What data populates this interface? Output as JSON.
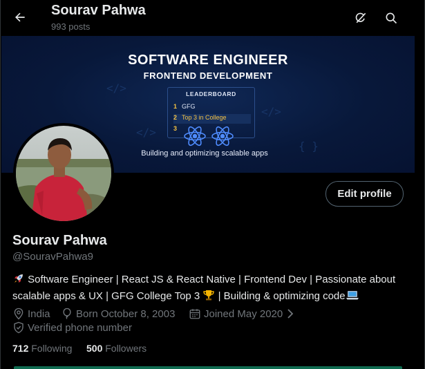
{
  "header": {
    "title": "Sourav Pahwa",
    "posts": "993 posts"
  },
  "banner": {
    "title": "SOFTWARE ENGINEER",
    "subtitle": "FRONTEND DEVELOPMENT",
    "leaderboard_title": "LEADERBOARD",
    "leaderboard_rows": [
      {
        "rank": "1",
        "text": "GFG"
      },
      {
        "rank": "2",
        "text": "Top 3 in College"
      },
      {
        "rank": "3",
        "text": ""
      }
    ],
    "caption": "Building and optimizing scalable apps"
  },
  "profile": {
    "edit_label": "Edit profile",
    "name": "Sourav Pahwa",
    "handle": "@SouravPahwa9",
    "bio_line1": "Software Engineer | React JS & React Native | Frontend Dev | Passionate about",
    "bio_line2a": "scalable apps & UX | GFG College Top 3",
    "bio_line2b": "| Building & optimizing code",
    "location": "India",
    "born": "Born October 8, 2003",
    "joined": "Joined May 2020",
    "verified": "Verified phone number",
    "following_count": "712",
    "following_label": "Following",
    "followers_count": "500",
    "followers_label": "Followers"
  },
  "colors": {
    "background": "#000000",
    "primary_text": "#e7e9ea",
    "secondary_text": "#71767b",
    "banner_bg": "#08183a",
    "leaderboard_accent": "#f6c343"
  },
  "icons": [
    "back-arrow-icon",
    "grok-icon",
    "search-icon",
    "location-pin-icon",
    "birthday-balloon-icon",
    "calendar-icon",
    "chevron-right-icon",
    "verified-shield-icon",
    "rocket-emoji",
    "trophy-emoji",
    "laptop-emoji"
  ]
}
